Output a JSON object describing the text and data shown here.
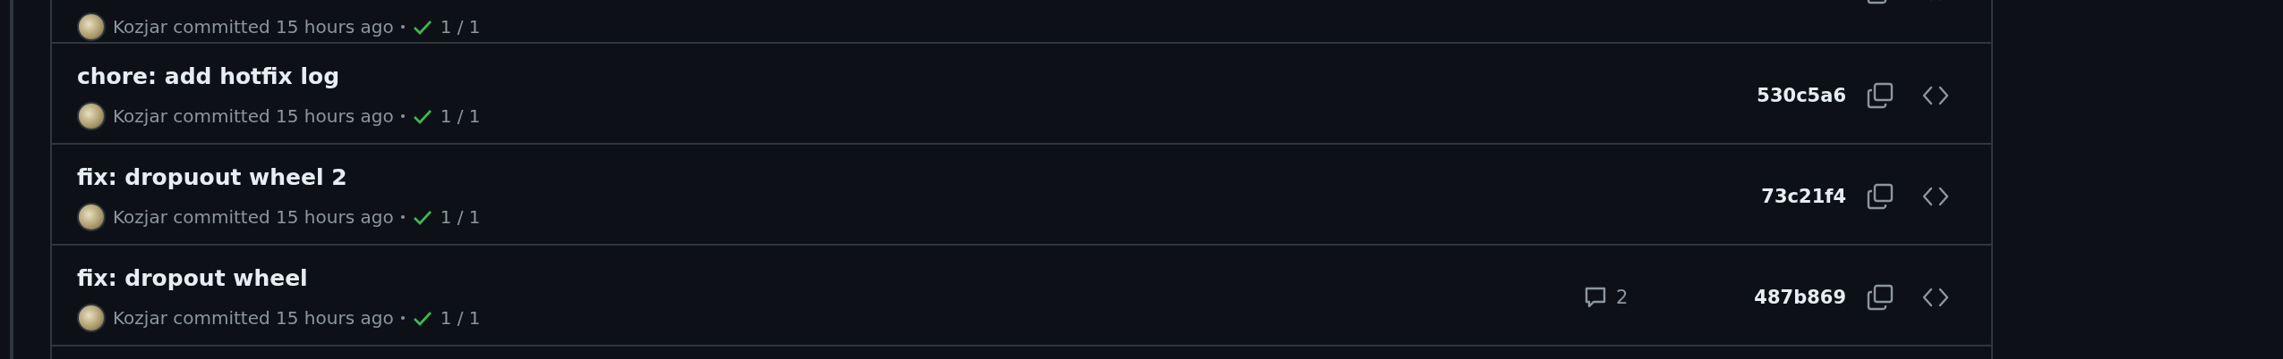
{
  "commits": [
    {
      "author": "Kozjar",
      "meta": "committed 15 hours ago",
      "checks_passed": true,
      "checks": "1 / 1"
    },
    {
      "title": "chore: add hotfix log",
      "author": "Kozjar",
      "meta": "committed 15 hours ago",
      "checks_passed": true,
      "checks": "1 / 1",
      "sha": "530c5a6"
    },
    {
      "title": "fix: dropuout wheel 2",
      "author": "Kozjar",
      "meta": "committed 15 hours ago",
      "checks_passed": true,
      "checks": "1 / 1",
      "sha": "73c21f4"
    },
    {
      "title": "fix: dropout wheel",
      "author": "Kozjar",
      "meta": "committed 15 hours ago",
      "checks_passed": true,
      "checks": "1 / 1",
      "comments": "2",
      "sha": "487b869"
    }
  ]
}
